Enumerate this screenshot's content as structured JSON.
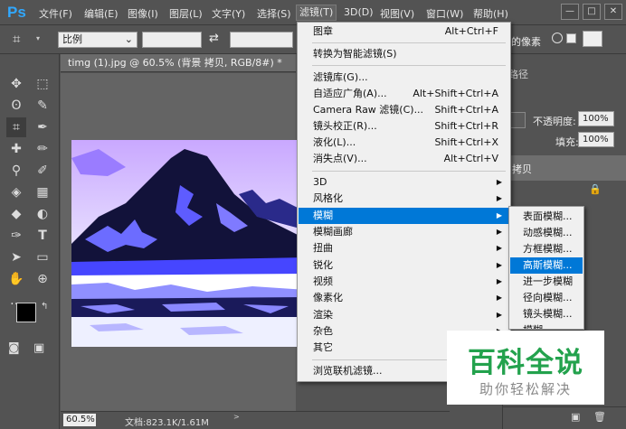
{
  "app": {
    "logo": "Ps"
  },
  "menubar": {
    "items": [
      "文件(F)",
      "编辑(E)",
      "图像(I)",
      "图层(L)",
      "文字(Y)",
      "选择(S)",
      "滤镜(T)",
      "3D(D)",
      "视图(V)",
      "窗口(W)",
      "帮助(H)"
    ],
    "active": "滤镜(T)",
    "window_controls": {
      "minimize": "—",
      "maximize": "□",
      "close": "✕"
    }
  },
  "options_bar": {
    "ratio_select": "比例",
    "ratio_arrow": "⌄",
    "swap_icon": "⇄",
    "right_text": "的像素"
  },
  "document": {
    "tab_title": "timg (1).jpg @ 60.5% (背景 拷贝, RGB/8#) *",
    "tab_close": "×",
    "zoom": "60.5%",
    "doc_info": "文档:823.1K/1.61M"
  },
  "filter_menu": {
    "items": [
      {
        "label": "图章",
        "shortcut": "Alt+Ctrl+F"
      },
      {
        "sep": true
      },
      {
        "label": "转换为智能滤镜(S)"
      },
      {
        "sep": true
      },
      {
        "label": "滤镜库(G)..."
      },
      {
        "label": "自适应广角(A)...",
        "shortcut": "Alt+Shift+Ctrl+A"
      },
      {
        "label": "Camera Raw 滤镜(C)...",
        "shortcut": "Shift+Ctrl+A"
      },
      {
        "label": "镜头校正(R)...",
        "shortcut": "Shift+Ctrl+R"
      },
      {
        "label": "液化(L)...",
        "shortcut": "Shift+Ctrl+X"
      },
      {
        "label": "消失点(V)...",
        "shortcut": "Alt+Ctrl+V"
      },
      {
        "sep": true
      },
      {
        "label": "3D",
        "submenu": true
      },
      {
        "label": "风格化",
        "submenu": true
      },
      {
        "label": "模糊",
        "submenu": true,
        "highlighted": true
      },
      {
        "label": "模糊画廊",
        "submenu": true
      },
      {
        "label": "扭曲",
        "submenu": true
      },
      {
        "label": "锐化",
        "submenu": true
      },
      {
        "label": "视频",
        "submenu": true
      },
      {
        "label": "像素化",
        "submenu": true
      },
      {
        "label": "渲染",
        "submenu": true
      },
      {
        "label": "杂色",
        "submenu": true
      },
      {
        "label": "其它",
        "submenu": true
      },
      {
        "sep": true
      },
      {
        "label": "浏览联机滤镜..."
      }
    ],
    "submenu_arrow": "▶"
  },
  "blur_submenu": {
    "items": [
      "表面模糊...",
      "动感模糊...",
      "方框模糊...",
      "高斯模糊...",
      "进一步模糊",
      "径向模糊...",
      "镜头模糊...",
      "模糊"
    ],
    "highlighted": "高斯模糊..."
  },
  "layers_panel": {
    "tab_label": "路径",
    "opacity_label": "不透明度:",
    "opacity_value": "100%",
    "fill_label": "填充:",
    "fill_value": "100%",
    "layer_name": "拷贝"
  },
  "watermark": {
    "title": "百科全说",
    "subtitle": "助你轻松解决"
  },
  "colors": {
    "highlight": "#0078d7",
    "brand_green": "#23a24d",
    "ps_blue": "#31a8ff"
  }
}
